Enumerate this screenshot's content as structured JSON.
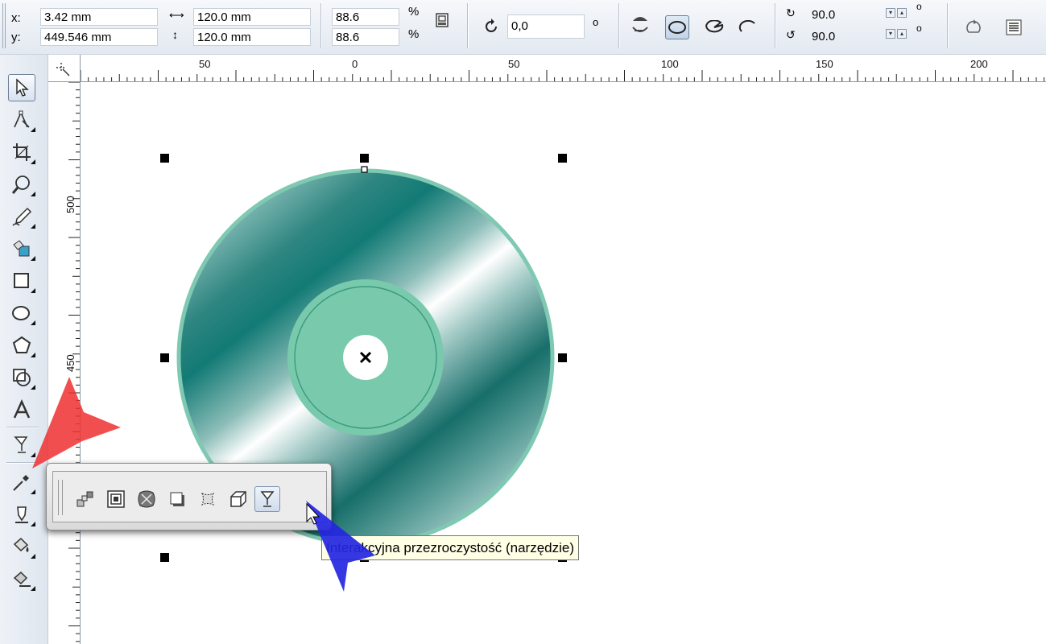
{
  "property_bar": {
    "x_label": "x:",
    "x_value": "3.42 mm",
    "y_label": "y:",
    "y_value": "449.546 mm",
    "width_value": "120.0 mm",
    "height_value": "120.0 mm",
    "scale_x_value": "88.6",
    "scale_y_value": "88.6",
    "percent_symbol": "%",
    "rotation_value": "0,0",
    "degree_symbol": "o",
    "start_angle_value": "90.0",
    "end_angle_value": "90.0"
  },
  "rulers": {
    "horizontal_labels": [
      "50",
      "0",
      "50",
      "100",
      "150",
      "200"
    ],
    "vertical_labels": [
      "500",
      "450"
    ]
  },
  "toolbox": {
    "tools": [
      "pick-tool",
      "shape-tool",
      "crop-tool",
      "zoom-tool",
      "freehand-tool",
      "smart-fill-tool",
      "rectangle-tool",
      "ellipse-tool",
      "polygon-tool",
      "basic-shapes-tool",
      "text-tool",
      "interactive-transparency-tool",
      "eyedropper-tool",
      "outline-pen-tool",
      "fill-tool",
      "interactive-fill-tool"
    ]
  },
  "flyout": {
    "tools": [
      "blend-tool",
      "contour-tool",
      "distort-tool",
      "drop-shadow-tool",
      "envelope-tool",
      "extrude-tool",
      "transparency-tool"
    ]
  },
  "tooltip": {
    "text": "Interakcyjna przezroczystość (narzędzie)"
  },
  "colors": {
    "disc_teal": "#137a75",
    "disc_light": "#7fc9b3",
    "label_green": "#79c9ad",
    "red_arrow": "#ee3030",
    "blue_cursor": "#2426e0"
  }
}
